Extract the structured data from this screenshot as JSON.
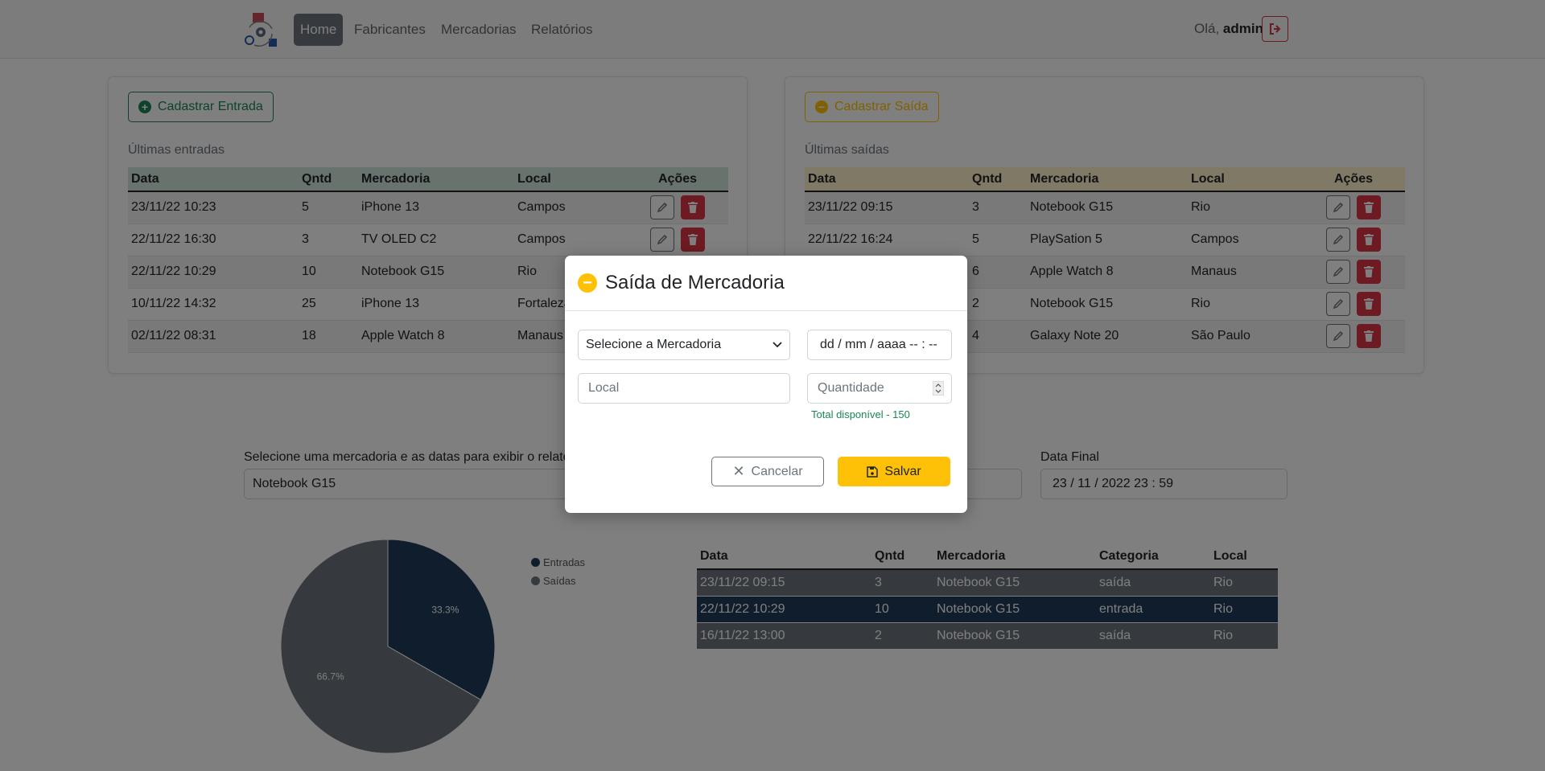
{
  "nav": {
    "items": [
      {
        "label": "Home",
        "active": true
      },
      {
        "label": "Fabricantes",
        "active": false
      },
      {
        "label": "Mercadorias",
        "active": false
      },
      {
        "label": "Relatórios",
        "active": false
      }
    ],
    "greeting_prefix": "Olá,",
    "user": "admin"
  },
  "entries": {
    "button_label": "Cadastrar Entrada",
    "section_label": "Últimas entradas",
    "columns": [
      "Data",
      "Qntd",
      "Mercadoria",
      "Local",
      "Ações"
    ],
    "rows": [
      {
        "data": "23/11/22 10:23",
        "qntd": "5",
        "mercadoria": "iPhone 13",
        "local": "Campos"
      },
      {
        "data": "22/11/22 16:30",
        "qntd": "3",
        "mercadoria": "TV OLED C2",
        "local": "Campos"
      },
      {
        "data": "22/11/22 10:29",
        "qntd": "10",
        "mercadoria": "Notebook G15",
        "local": "Rio"
      },
      {
        "data": "10/11/22 14:32",
        "qntd": "25",
        "mercadoria": "iPhone 13",
        "local": "Fortaleza"
      },
      {
        "data": "02/11/22 08:31",
        "qntd": "18",
        "mercadoria": "Apple Watch 8",
        "local": "Manaus"
      }
    ]
  },
  "exits": {
    "button_label": "Cadastrar Saída",
    "section_label": "Últimas saídas",
    "columns": [
      "Data",
      "Qntd",
      "Mercadoria",
      "Local",
      "Ações"
    ],
    "rows": [
      {
        "data": "23/11/22 09:15",
        "qntd": "3",
        "mercadoria": "Notebook G15",
        "local": "Rio"
      },
      {
        "data": "22/11/22 16:24",
        "qntd": "5",
        "mercadoria": "PlaySation 5",
        "local": "Campos"
      },
      {
        "data": "",
        "qntd": "6",
        "mercadoria": "Apple Watch 8",
        "local": "Manaus"
      },
      {
        "data": "",
        "qntd": "2",
        "mercadoria": "Notebook G15",
        "local": "Rio"
      },
      {
        "data": "",
        "qntd": "4",
        "mercadoria": "Galaxy Note 20",
        "local": "São Paulo"
      }
    ]
  },
  "report": {
    "select_label": "Selecione uma mercadoria e as datas para exibir o relatór",
    "selected_item": "Notebook G15",
    "data_final_label": "Data Final",
    "data_final_value": "23 / 11 / 2022   23 : 59",
    "columns": [
      "Data",
      "Qntd",
      "Mercadoria",
      "Categoria",
      "Local"
    ],
    "rows": [
      {
        "data": "23/11/22 09:15",
        "qntd": "3",
        "mercadoria": "Notebook G15",
        "categoria": "saída",
        "local": "Rio",
        "type": "out"
      },
      {
        "data": "22/11/22 10:29",
        "qntd": "10",
        "mercadoria": "Notebook G15",
        "categoria": "entrada",
        "local": "Rio",
        "type": "in"
      },
      {
        "data": "16/11/22 13:00",
        "qntd": "2",
        "mercadoria": "Notebook G15",
        "categoria": "saída",
        "local": "Rio",
        "type": "out"
      }
    ]
  },
  "chart_data": {
    "type": "pie",
    "labels": [
      "Entradas",
      "Saídas"
    ],
    "values": [
      33.3,
      66.7
    ],
    "value_labels": [
      "33.3%",
      "66.7%"
    ],
    "colors": [
      "#1e3a5a",
      "#6c757d"
    ],
    "legend_position": "right"
  },
  "modal": {
    "title": "Saída de Mercadoria",
    "select_placeholder": "Selecione a Mercadoria",
    "datetime_placeholder": "dd / mm / aaaa  -- : --",
    "local_placeholder": "Local",
    "quantity_placeholder": "Quantidade",
    "available_text": "Total disponível - 150",
    "cancel_label": "Cancelar",
    "save_label": "Salvar"
  },
  "colors": {
    "green": "#198754",
    "yellow": "#ffc107",
    "red": "#dc3545",
    "entry_series": "#1e3a5a",
    "exit_series": "#6c757d"
  }
}
